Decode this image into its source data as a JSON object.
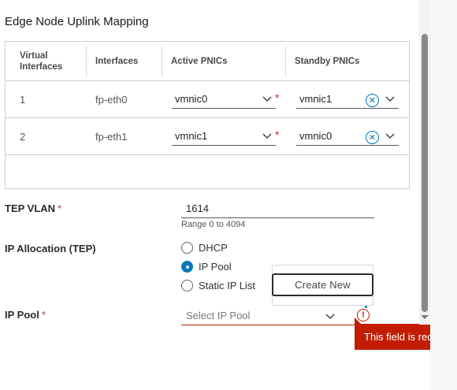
{
  "section": {
    "title": "Edge Node Uplink Mapping"
  },
  "table": {
    "headers": [
      "Virtual Interfaces",
      "Interfaces",
      "Active PNICs",
      "Standby PNICs"
    ],
    "rows": [
      {
        "virtual_interface": "1",
        "interface": "fp-eth0",
        "active_pnic": "vmnic0",
        "standby_pnic": "vmnic1"
      },
      {
        "virtual_interface": "2",
        "interface": "fp-eth1",
        "active_pnic": "vmnic1",
        "standby_pnic": "vmnic0"
      }
    ],
    "required_marker": "*"
  },
  "tep_vlan": {
    "label": "TEP VLAN",
    "value": "1614",
    "hint": "Range 0 to 4094",
    "required_marker": "*"
  },
  "ip_allocation": {
    "label": "IP Allocation (TEP)",
    "options": [
      {
        "label": "DHCP",
        "checked": false
      },
      {
        "label": "IP Pool",
        "checked": true
      },
      {
        "label": "Static IP List",
        "checked": false
      }
    ]
  },
  "dropdown_popup": {
    "create_new_label": "Create New"
  },
  "ip_pool": {
    "label": "IP Pool",
    "required_marker": "*",
    "placeholder": "Select IP Pool",
    "error_text": "This field is required"
  },
  "icons": {
    "chevron": "chevron-down-icon",
    "clear": "clear-icon",
    "error": "error-icon"
  },
  "colors": {
    "required": "#d9232e",
    "error": "#c21d00",
    "accent": "#0079b8"
  }
}
